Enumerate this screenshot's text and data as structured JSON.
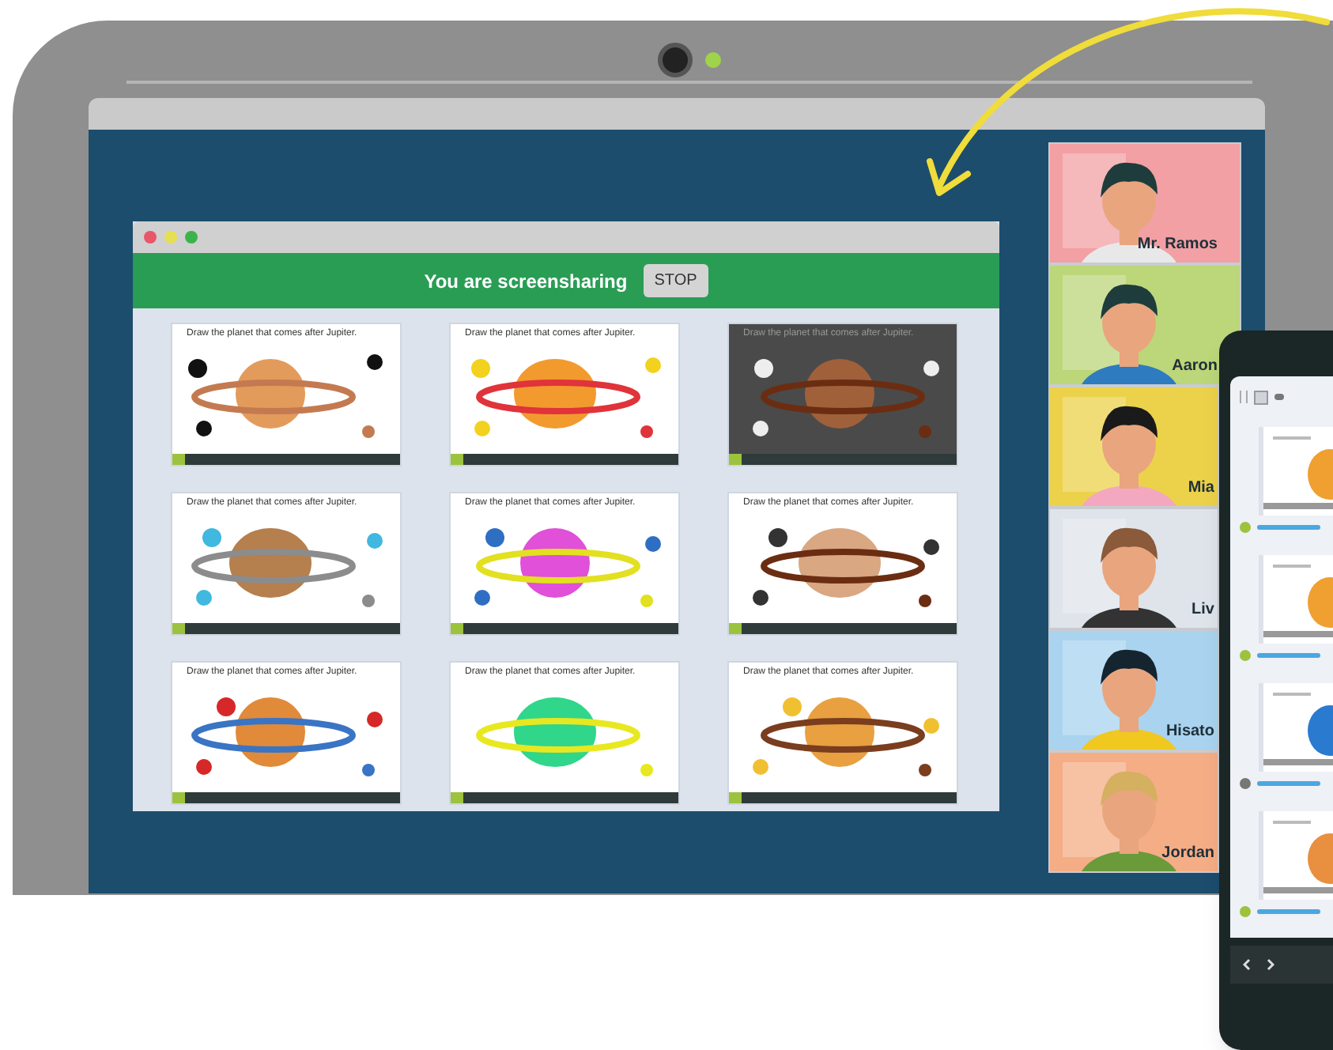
{
  "share_window": {
    "banner": "You are screensharing",
    "stop_button": "STOP"
  },
  "slides": [
    {
      "caption": "Draw the planet that comes after Jupiter."
    },
    {
      "caption": "Draw the planet that comes after Jupiter."
    },
    {
      "caption": "Draw the planet that comes after Jupiter."
    },
    {
      "caption": "Draw the planet that comes after Jupiter."
    },
    {
      "caption": "Draw the planet that comes after Jupiter."
    },
    {
      "caption": "Draw the planet that comes after Jupiter."
    },
    {
      "caption": "Draw the planet that comes after Jupiter."
    },
    {
      "caption": "Draw the planet that comes after Jupiter."
    },
    {
      "caption": "Draw the planet that comes after Jupiter."
    }
  ],
  "participants": [
    {
      "name": "Mr. Ramos",
      "color": "#f2a0a4"
    },
    {
      "name": "Aaron",
      "color": "#bcd67a"
    },
    {
      "name": "Mia",
      "color": "#ecd24a"
    },
    {
      "name": "Liv",
      "color": "#dfe3ea"
    },
    {
      "name": "Hisato",
      "color": "#a9d3ef"
    },
    {
      "name": "Jordan",
      "color": "#f5ad86"
    }
  ]
}
